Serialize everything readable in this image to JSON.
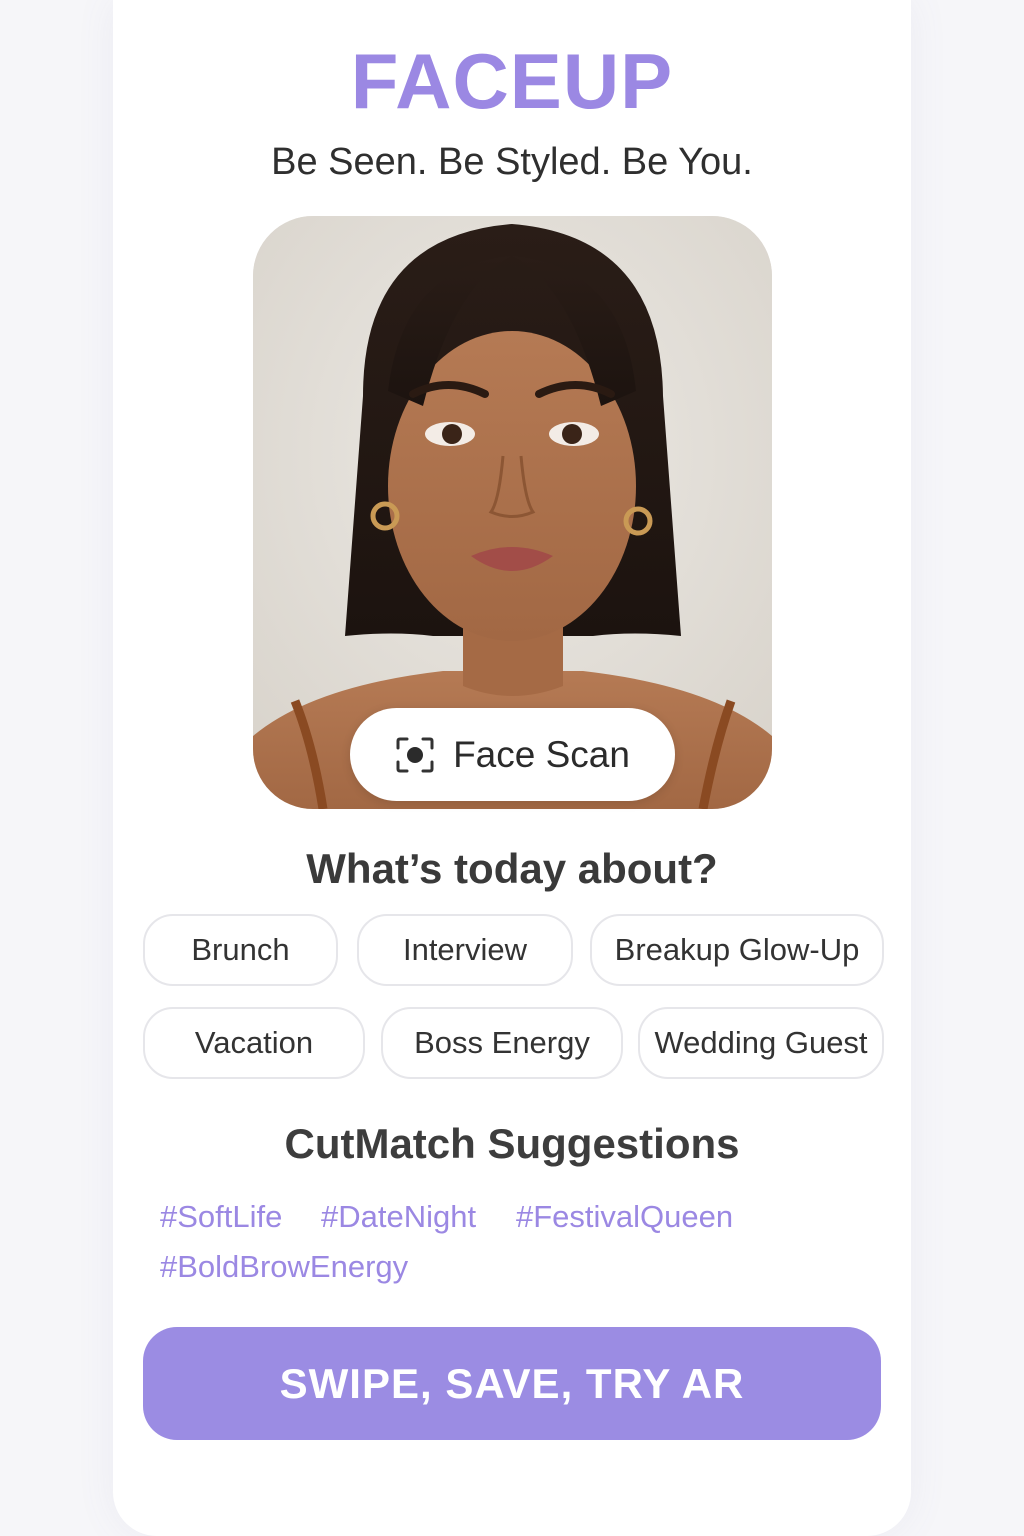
{
  "app": {
    "brand": "FACEUP",
    "tagline": "Be Seen. Be Styled. Be You."
  },
  "photo": {
    "scan_button_label": "Face Scan",
    "scan_icon": "face-scan-icon"
  },
  "occasion": {
    "question": "What’s today about?",
    "chips": [
      "Brunch",
      "Interview",
      "Breakup Glow-Up",
      "Vacation",
      "Boss Energy",
      "Wedding Guest"
    ]
  },
  "suggestions": {
    "title": "CutMatch Suggestions",
    "hashtags": [
      "#SoftLife",
      "#DateNight",
      "#FestivalQueen",
      "#BoldBrowEnergy"
    ]
  },
  "cta": {
    "label": "SWIPE, SAVE, TRY AR"
  },
  "colors": {
    "accent": "#9b88e3",
    "cta_background": "#9b8ce3",
    "text_dark": "#2f2f2f"
  }
}
